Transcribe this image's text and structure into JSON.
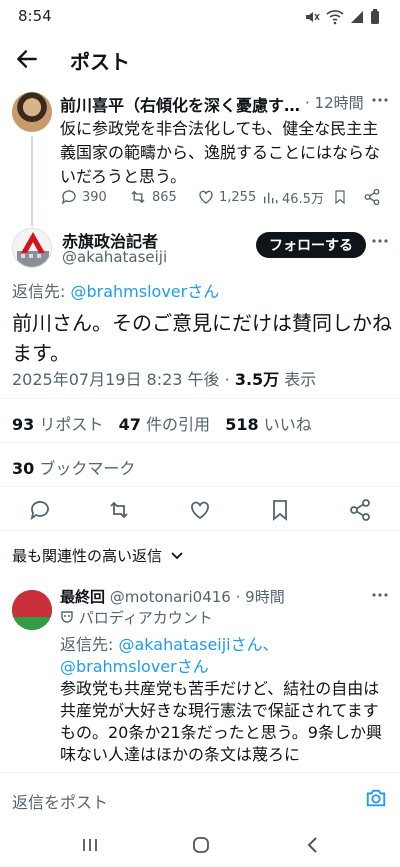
{
  "status_bar": {
    "time": "8:54"
  },
  "header": {
    "title": "ポスト"
  },
  "parent_post": {
    "author": "前川喜平（右傾化を深く憂慮す…",
    "time": "· 12時間",
    "text": "仮に参政党を非合法化しても、健全な民主主義国家の範疇から、逸脱することにはならないだろうと思う。",
    "replies": "390",
    "reposts": "865",
    "likes": "1,255",
    "views": "46.5万"
  },
  "main_post": {
    "author": "赤旗政治記者",
    "handle": "@akahataseiji",
    "follow_label": "フォローする",
    "reply_to_prefix": "返信先: ",
    "reply_to_user": "@brahmsloverさん",
    "text": "前川さん。そのご意見にだけは賛同しかねます。",
    "datetime": "2025年07月19日 8:23 午後 · ",
    "views_count": "3.5万",
    "views_label": " 表示",
    "reposts_count": "93",
    "reposts_label": " リポスト",
    "quotes_count": "47",
    "quotes_label": " 件の引用",
    "likes_count": "518",
    "likes_label": " いいね",
    "bookmarks_count": "30",
    "bookmarks_label": " ブックマーク"
  },
  "replies_sort": {
    "label": "最も関連性の高い返信"
  },
  "reply": {
    "author": "最終回",
    "handle_time": "@motonari0416 · 9時間",
    "parody_label": "パロディアカウント",
    "reply_to_prefix": "返信先: ",
    "reply_to_users": "@akahataseijiさん、@brahmsloverさん",
    "text": "参政党も共産党も苦手だけど、結社の自由は共産党が大好きな現行憲法で保証されてますもの。20条か21条だったと思う。9条しか興味ない人達はほかの条文は蔑ろに"
  },
  "compose": {
    "placeholder": "返信をポスト"
  },
  "colors": {
    "accent": "#1d9bf0",
    "text": "#0f1419",
    "muted": "#536471"
  }
}
